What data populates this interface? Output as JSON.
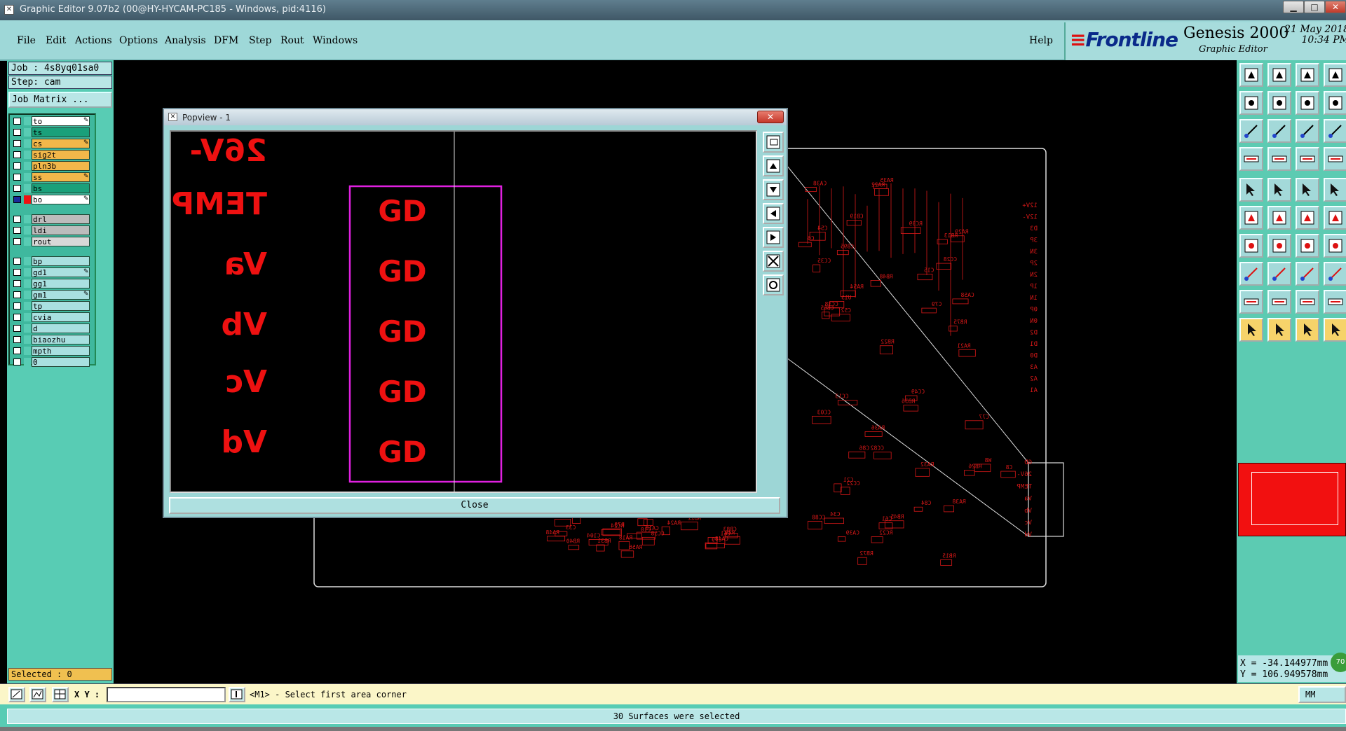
{
  "window": {
    "title": "Graphic Editor 9.07b2 (00@HY-HYCAM-PC185 - Windows, pid:4116)",
    "min_label": "▁",
    "max_label": "□",
    "close_label": "✕"
  },
  "menu": {
    "items": [
      "File",
      "Edit",
      "Actions",
      "Options",
      "Analysis",
      "DFM",
      "Step",
      "Rout",
      "Windows"
    ],
    "help": "Help"
  },
  "brand": {
    "logo": "Frontline",
    "product": "Genesis 2000",
    "subtitle": "Graphic Editor",
    "date": "21 May 2018",
    "time": "10:34 PM"
  },
  "left_panel": {
    "job": "Job : 4s8yq01sa0",
    "step": "Step: cam",
    "job_matrix": "Job Matrix ...",
    "layers": [
      {
        "name": "to",
        "color": "#ffffff",
        "swatch": "#58ccb4",
        "checked": false,
        "editable": true
      },
      {
        "name": "ts",
        "color": "#1aa07a",
        "swatch": "#58ccb4",
        "checked": false,
        "editable": false
      },
      {
        "name": "cs",
        "color": "#f2b74a",
        "swatch": "#58ccb4",
        "checked": false,
        "editable": true
      },
      {
        "name": "sig2t",
        "color": "#f2b74a",
        "swatch": "#58ccb4",
        "checked": false,
        "editable": false
      },
      {
        "name": "pln3b",
        "color": "#f2b74a",
        "swatch": "#58ccb4",
        "checked": false,
        "editable": false
      },
      {
        "name": "ss",
        "color": "#f2b74a",
        "swatch": "#58ccb4",
        "checked": false,
        "editable": true
      },
      {
        "name": "bs",
        "color": "#1aa07a",
        "swatch": "#58ccb4",
        "checked": false,
        "editable": false
      },
      {
        "name": "bo",
        "color": "#ffffff",
        "swatch": "#ee1111",
        "checked": true,
        "editable": true
      },
      {
        "name": "drl",
        "color": "#bcbcbc",
        "swatch": "#58ccb4",
        "checked": false,
        "editable": false
      },
      {
        "name": "ldi",
        "color": "#bcbcbc",
        "swatch": "#58ccb4",
        "checked": false,
        "editable": false
      },
      {
        "name": "rout",
        "color": "#d8d8d8",
        "swatch": "#58ccb4",
        "checked": false,
        "editable": false
      },
      {
        "name": "bp",
        "color": "#a9e0e0",
        "swatch": "#58ccb4",
        "checked": false,
        "editable": false
      },
      {
        "name": "gd1",
        "color": "#a9e0e0",
        "swatch": "#58ccb4",
        "checked": false,
        "editable": true
      },
      {
        "name": "gg1",
        "color": "#a9e0e0",
        "swatch": "#58ccb4",
        "checked": false,
        "editable": false
      },
      {
        "name": "gm1",
        "color": "#a9e0e0",
        "swatch": "#58ccb4",
        "checked": false,
        "editable": true
      },
      {
        "name": "tp",
        "color": "#a9e0e0",
        "swatch": "#58ccb4",
        "checked": false,
        "editable": false
      },
      {
        "name": "cvia",
        "color": "#a9e0e0",
        "swatch": "#58ccb4",
        "checked": false,
        "editable": false
      },
      {
        "name": "d",
        "color": "#a9e0e0",
        "swatch": "#58ccb4",
        "checked": false,
        "editable": false
      },
      {
        "name": "biaozhu",
        "color": "#a9e0e0",
        "swatch": "#58ccb4",
        "checked": false,
        "editable": false
      },
      {
        "name": "mpth",
        "color": "#a9e0e0",
        "swatch": "#58ccb4",
        "checked": false,
        "editable": false
      },
      {
        "name": "0",
        "color": "#a9e0e0",
        "swatch": "#58ccb4",
        "checked": false,
        "editable": false
      }
    ],
    "selected": "Selected : 0"
  },
  "popview": {
    "title": "Popview - 1",
    "close_x": "✕",
    "labels": [
      "26V-",
      "TEMP",
      "Va",
      "Vb",
      "Vc",
      "Vd"
    ],
    "pads": [
      "GD",
      "GD",
      "GD",
      "GD",
      "GD"
    ],
    "close_button": "Close",
    "colors": {
      "text": "#ee1111",
      "selection": "#e020e0"
    }
  },
  "board": {
    "right_labels": [
      "12V+",
      "12V-",
      "D3",
      "3P",
      "3N",
      "2P",
      "2N",
      "1P",
      "1N",
      "0P",
      "0N",
      "D2",
      "D1",
      "D0",
      "A3",
      "A2",
      "A1",
      "GD",
      "26V-",
      "TEMP",
      "Va",
      "Vb",
      "Vc",
      "Vd"
    ],
    "component_labels": [
      "RB48",
      "RB36",
      "RB31",
      "U15",
      "CC13",
      "RA56",
      "RC39",
      "CC22",
      "RC24",
      "CC28",
      "RA38",
      "CC41",
      "RA29",
      "RB26",
      "RB22",
      "RA21",
      "CC49",
      "RA18",
      "C6",
      "C8",
      "RB40",
      "CC38",
      "CA39",
      "RA48",
      "RA35",
      "RA36",
      "CB34",
      "CC35",
      "RB45",
      "RA24",
      "CA38",
      "RA32",
      "CA18",
      "RB22",
      "W8",
      "R49",
      "RA22",
      "C61",
      "CA48",
      "CA58",
      "C21",
      "C09",
      "C52",
      "RC22",
      "C61",
      "CB95",
      "CC88",
      "C33",
      "CB65",
      "C86",
      "C104",
      "RB75",
      "C34",
      "R78",
      "C79",
      "RB15",
      "CC58",
      "C15",
      "CC03",
      "CB83",
      "RB13",
      "CC82",
      "CC95",
      "CB19",
      "C84",
      "C10",
      "C54",
      "C77",
      "C79",
      "RA54",
      "RB72"
    ],
    "colors": {
      "trace": "#d81818",
      "outline": "#dddddd"
    }
  },
  "right_toolbar": {
    "coords_x": "X = -34.144977mm",
    "coords_y": "Y = 106.949578mm",
    "zoom": "70"
  },
  "command_bar": {
    "xy_label": "X Y :",
    "xy_value": "",
    "prompt": "<M1> - Select first area corner",
    "units": "MM"
  },
  "status": {
    "message": "30 Surfaces were selected"
  }
}
